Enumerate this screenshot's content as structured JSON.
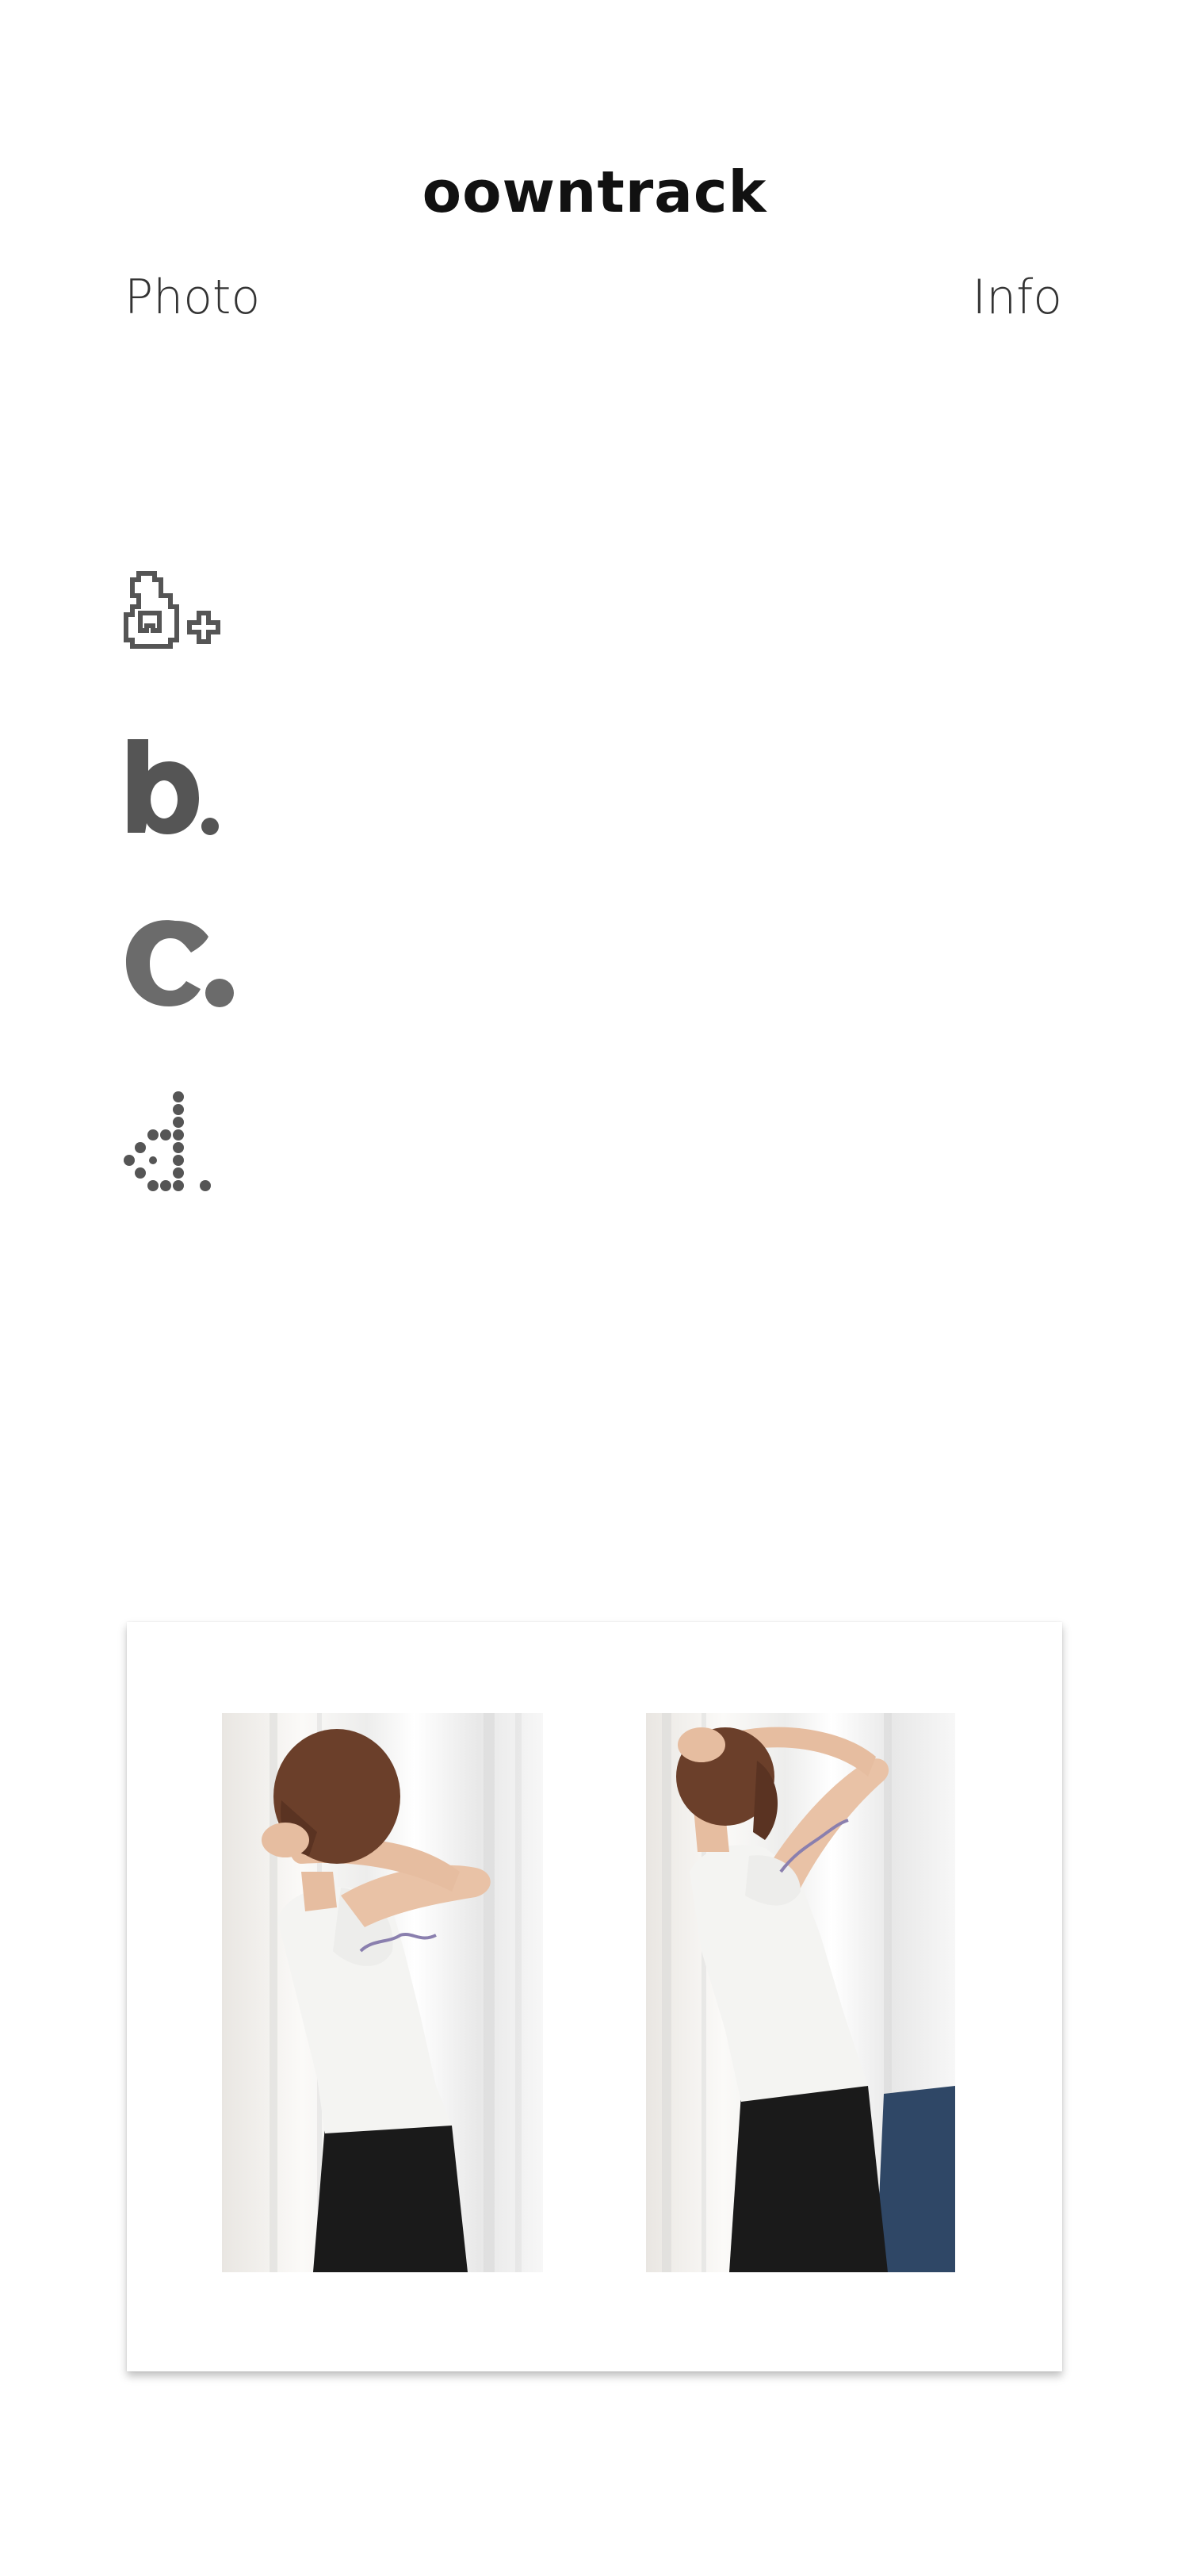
{
  "header": {
    "title": "oowntrack",
    "nav_left": "Photo",
    "nav_right": "Info"
  },
  "variants": [
    {
      "letter": "a",
      "style": "pixel-outline"
    },
    {
      "letter": "b",
      "style": "bold"
    },
    {
      "letter": "c",
      "style": "blob"
    },
    {
      "letter": "d",
      "style": "dotted"
    }
  ],
  "colors": {
    "background": "#ffffff",
    "text": "#111111",
    "glyph": "#555555",
    "glyph_light": "#6b6b6b",
    "skirt": "#1a1a1a",
    "shirt": "#f4f4f2",
    "hair": "#6b3f2a",
    "skin": "#e9c2a6"
  },
  "photos": [
    {
      "label": "left-photo",
      "pose": "side view, hands behind head"
    },
    {
      "label": "right-photo",
      "pose": "side view, arms raised overhead"
    }
  ]
}
